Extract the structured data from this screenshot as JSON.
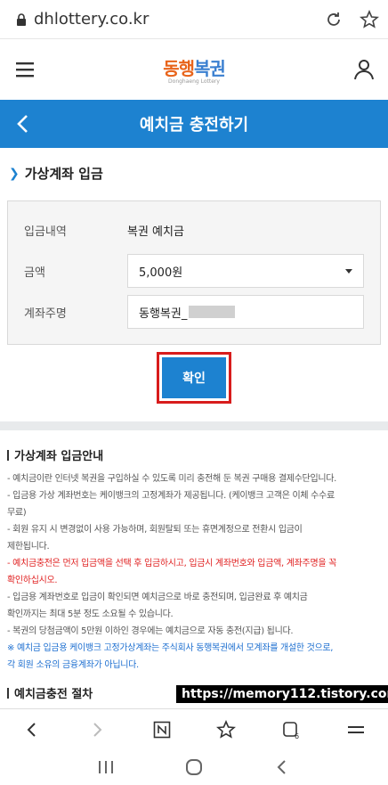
{
  "browser": {
    "url": "dhlottery.co.kr"
  },
  "header": {
    "logo_main": "동행",
    "logo_accent": "복권",
    "logo_sub": "Donghaeng Lottery"
  },
  "title_bar": {
    "title": "예치금 충전하기"
  },
  "section": {
    "title": "가상계좌 입금"
  },
  "form": {
    "row1": {
      "label": "입금내역",
      "value": "복권 예치금"
    },
    "row2": {
      "label": "금액",
      "value": "5,000원"
    },
    "row3": {
      "label": "계좌주명",
      "value": "동행복권_"
    }
  },
  "confirm": {
    "label": "확인"
  },
  "info": {
    "title": "가상계좌 입금안내",
    "lines": [
      "- 예치금이란 인터넷 복권을 구입하실 수 있도록 미리 충전해 둔 복권 구매용 결제수단입니다.",
      "- 입금용 가상 계좌번호는 케이뱅크의 고정계좌가 제공됩니다. (케이뱅크 고객은 이체 수수료",
      "  무료)",
      "- 회원 유지 시 변경없이 사용 가능하며, 회원탈퇴 또는 휴면계정으로 전환시 입금이",
      "  제한됩니다.",
      "- 예치금충전은 먼저 입금액을 선택 후 입금하시고, 입금시 계좌번호와 입금액, 계좌주명을 꼭",
      "  확인하십시오.",
      "- 입금용 계좌번호로 입금이 확인되면 예치금으로 바로 충전되며, 입금완료 후 예치금",
      "  확인까지는 최대 5분 정도 소요될 수 있습니다.",
      "- 복권의 당첨금액이 5만원 이하인 경우에는 예치금으로 자동 충전(지급) 됩니다.",
      "※ 예치금 입금용 케이뱅크 고정가상계좌는 주식회사 동행복권에서 모계좌를 개설한 것으로,",
      "  각 회원 소유의 금융계좌가 아닙니다."
    ],
    "title2": "예치금충전 절차"
  },
  "watermark": "https://memory112.tistory.com",
  "colors": {
    "accent": "#1d82d0",
    "alert": "#e02020",
    "note": "#1d6fd0"
  }
}
